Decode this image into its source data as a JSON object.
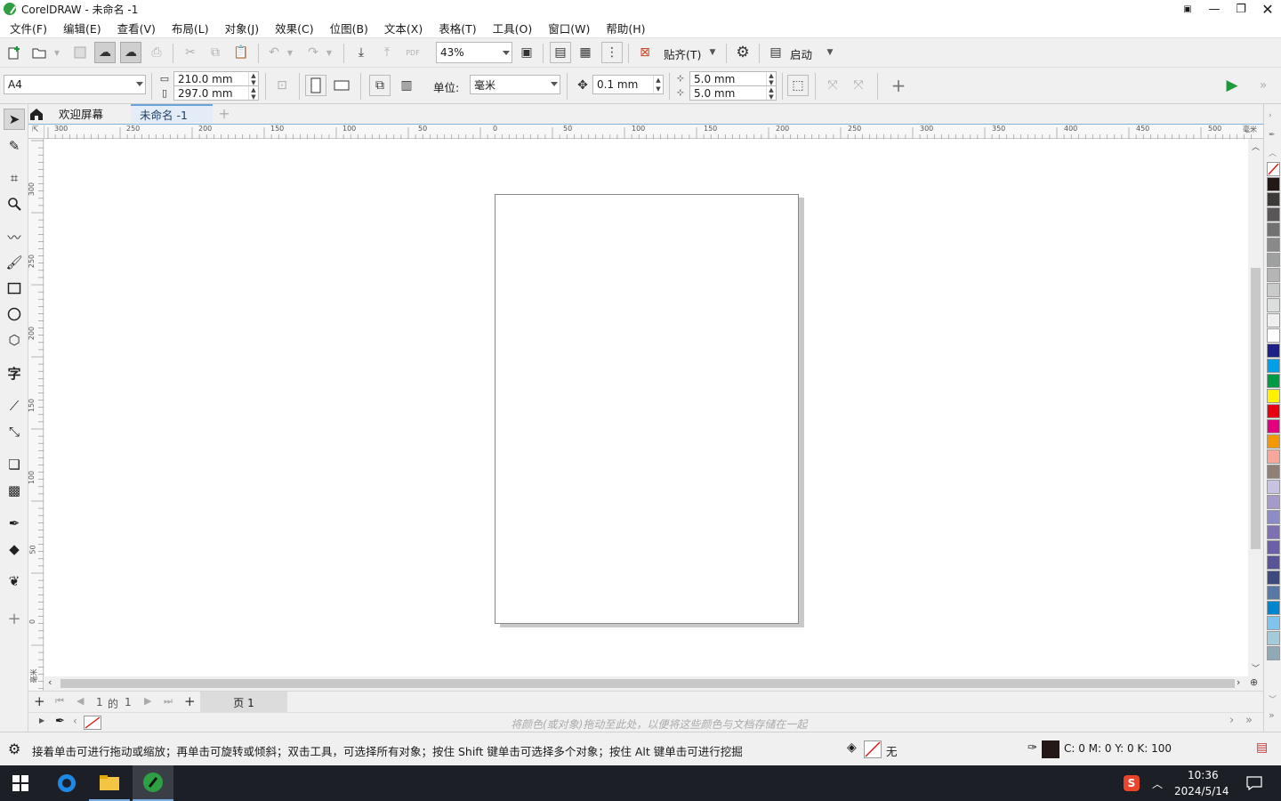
{
  "window": {
    "title": "CorelDRAW - 未命名 -1"
  },
  "menu": [
    "文件(F)",
    "编辑(E)",
    "查看(V)",
    "布局(L)",
    "对象(J)",
    "效果(C)",
    "位图(B)",
    "文本(X)",
    "表格(T)",
    "工具(O)",
    "窗口(W)",
    "帮助(H)"
  ],
  "toolbar": {
    "zoom": "43%",
    "snap_label": "贴齐(T)",
    "launch_label": "启动"
  },
  "properties": {
    "page_size": "A4",
    "width": "210.0 mm",
    "height": "297.0 mm",
    "units_label": "单位:",
    "units_value": "毫米",
    "nudge": "0.1 mm",
    "dup_x": "5.0 mm",
    "dup_y": "5.0 mm"
  },
  "tabs": {
    "welcome": "欢迎屏幕",
    "document": "未命名 -1"
  },
  "rulers": {
    "h_ticks": [
      "300",
      "250",
      "200",
      "150",
      "100",
      "50",
      "0",
      "50",
      "100",
      "150",
      "200",
      "250",
      "300",
      "350",
      "400",
      "450",
      "500"
    ],
    "h_unit": "毫米",
    "v_ticks": [
      "300",
      "250",
      "200",
      "150",
      "100",
      "50",
      "0"
    ],
    "v_unit": "毫米"
  },
  "pagenav": {
    "current": "1",
    "of_label": "的",
    "total": "1",
    "page_tab": "页 1"
  },
  "doc_palette_hint": "将颜色(或对象)拖动至此处，以便将这些颜色与文档存储在一起",
  "status": {
    "hint": "接着单击可进行拖动或缩放；再单击可旋转或倾斜；双击工具，可选择所有对象；按住 Shift 键单击可选择多个对象；按住 Alt 键单击可进行挖掘",
    "fill_label": "无",
    "outline_color": "C: 0 M: 0 Y: 0 K: 100"
  },
  "palette_colors": [
    "#231815",
    "#3e3a39",
    "#595757",
    "#727171",
    "#898989",
    "#9fa0a0",
    "#b5b5b6",
    "#c9caca",
    "#dcdddd",
    "#efefef",
    "#ffffff",
    "#1d2088",
    "#00a0e9",
    "#009944",
    "#fff100",
    "#e60012",
    "#e4007f",
    "#f39800",
    "#f5a89a",
    "#8f7f75",
    "#c9c3e3",
    "#a59aca",
    "#8c8cc8",
    "#7f6fb3",
    "#6a5fa8",
    "#585497",
    "#3e4a7e",
    "#5977a7",
    "#0086d1",
    "#7fc4ee",
    "#a4cbdc",
    "#8fa9b7"
  ],
  "taskbar": {
    "time": "10:36",
    "date": "2024/5/14"
  }
}
